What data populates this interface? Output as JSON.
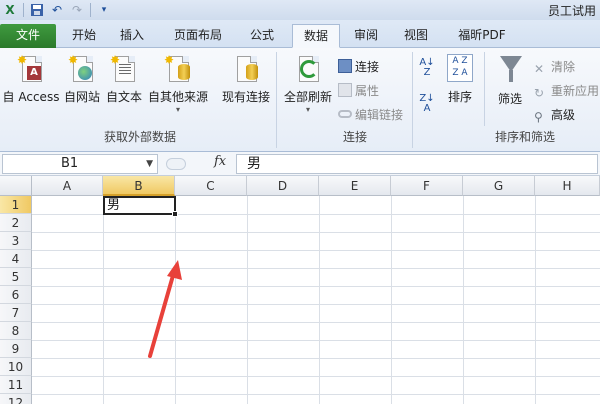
{
  "titlebar": {
    "app_title": "员工试用",
    "icons": [
      "excel-icon",
      "save-icon",
      "undo-icon",
      "redo-icon",
      "customize-qat-icon"
    ]
  },
  "tabs": [
    {
      "label": "文件",
      "active": false
    },
    {
      "label": "开始",
      "active": false
    },
    {
      "label": "插入",
      "active": false
    },
    {
      "label": "页面布局",
      "active": false
    },
    {
      "label": "公式",
      "active": false
    },
    {
      "label": "数据",
      "active": true
    },
    {
      "label": "审阅",
      "active": false
    },
    {
      "label": "视图",
      "active": false
    },
    {
      "label": "福昕PDF",
      "active": false
    }
  ],
  "ribbon": {
    "external": {
      "group_label": "获取外部数据",
      "from_access": "自 Access",
      "from_web": "自网站",
      "from_text": "自文本",
      "from_other": "自其他来源",
      "existing": "现有连接"
    },
    "connections": {
      "group_label": "连接",
      "refresh_all": "全部刷新",
      "connections": "连接",
      "properties": "属性",
      "edit_links": "编辑链接"
    },
    "sort_filter": {
      "group_label": "排序和筛选",
      "sort": "排序",
      "filter": "筛选",
      "clear": "清除",
      "reapply": "重新应用",
      "advanced": "高级"
    }
  },
  "formula_bar": {
    "name_box": "B1",
    "fx": "fx",
    "value": "男"
  },
  "grid": {
    "columns": [
      "A",
      "B",
      "C",
      "D",
      "E",
      "F",
      "G",
      "H"
    ],
    "rows": [
      "1",
      "2",
      "3",
      "4",
      "5",
      "6",
      "7",
      "8",
      "9",
      "10",
      "11",
      "12"
    ],
    "selected_column": "B",
    "selected_row": "1",
    "cell_b1": "男"
  },
  "colors": {
    "file_tab": "#2b7a2b",
    "selection_header": "#f0c963",
    "arrow": "#e8413a"
  }
}
